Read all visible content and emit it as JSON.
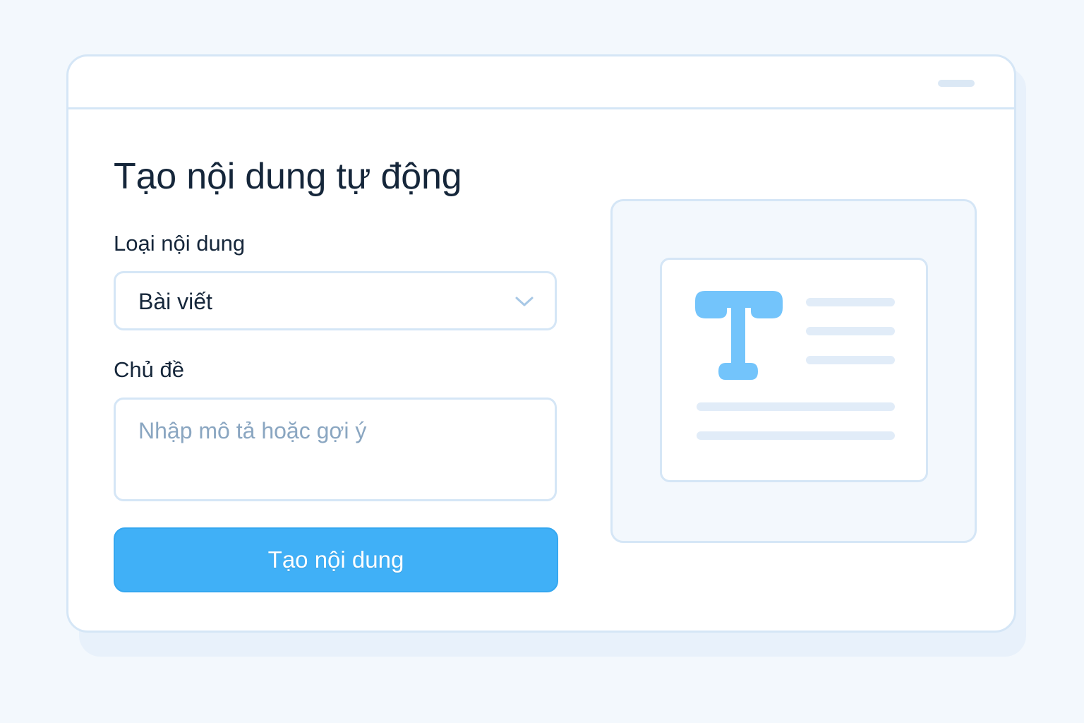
{
  "page": {
    "title": "Tạo nội dung tự động"
  },
  "form": {
    "content_type": {
      "label": "Loại nội dung",
      "selected_value": "Bài viết"
    },
    "topic": {
      "label": "Chủ đề",
      "placeholder": "Nhập mô tả hoặc gợi ý",
      "value": ""
    },
    "submit_label": "Tạo nội dung"
  },
  "preview": {
    "icon": "text-format-icon"
  },
  "colors": {
    "background": "#f3f8fd",
    "accent": "#40b0f7",
    "icon": "#73c4fb",
    "border": "#d5e6f6",
    "text": "#15263a",
    "placeholder": "#8aa6c1"
  }
}
